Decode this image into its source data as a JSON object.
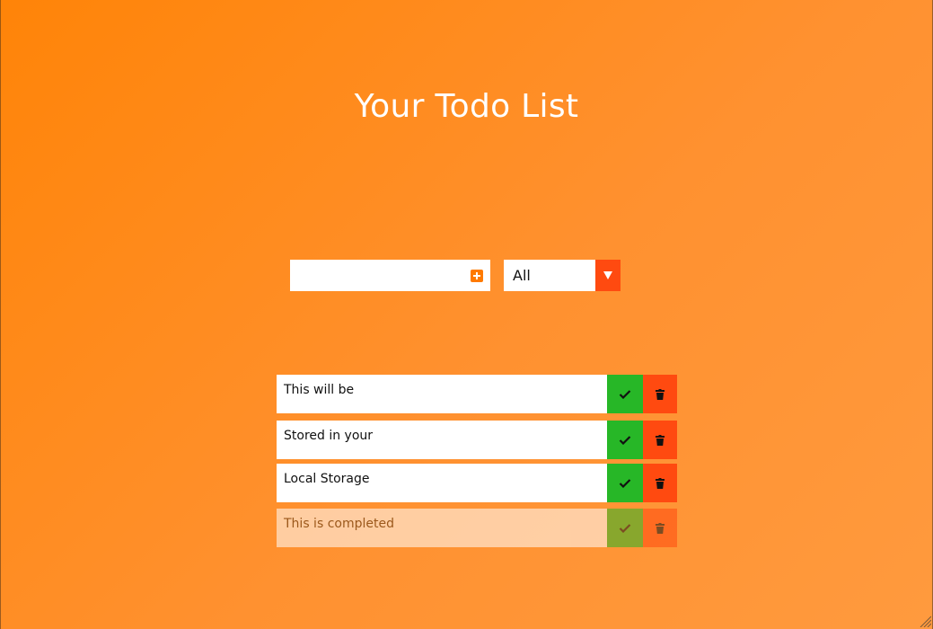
{
  "header": {
    "title": "Your Todo List"
  },
  "form": {
    "input_value": "",
    "add_icon": "plus-square-icon",
    "filter_selected": "All",
    "filter_arrow_icon": "triangle-down-icon"
  },
  "todos": [
    {
      "text": "This will be",
      "completed": false
    },
    {
      "text": "Stored in your",
      "completed": false
    },
    {
      "text": "Local Storage",
      "completed": false
    },
    {
      "text": "This is completed",
      "completed": true
    }
  ],
  "icons": {
    "complete": "check-icon",
    "delete": "trash-icon"
  },
  "colors": {
    "background_start": "#ff8408",
    "background_end": "#ff9a3e",
    "complete": "#27b727",
    "delete": "#ff4a10",
    "accent": "#ff7a00"
  }
}
